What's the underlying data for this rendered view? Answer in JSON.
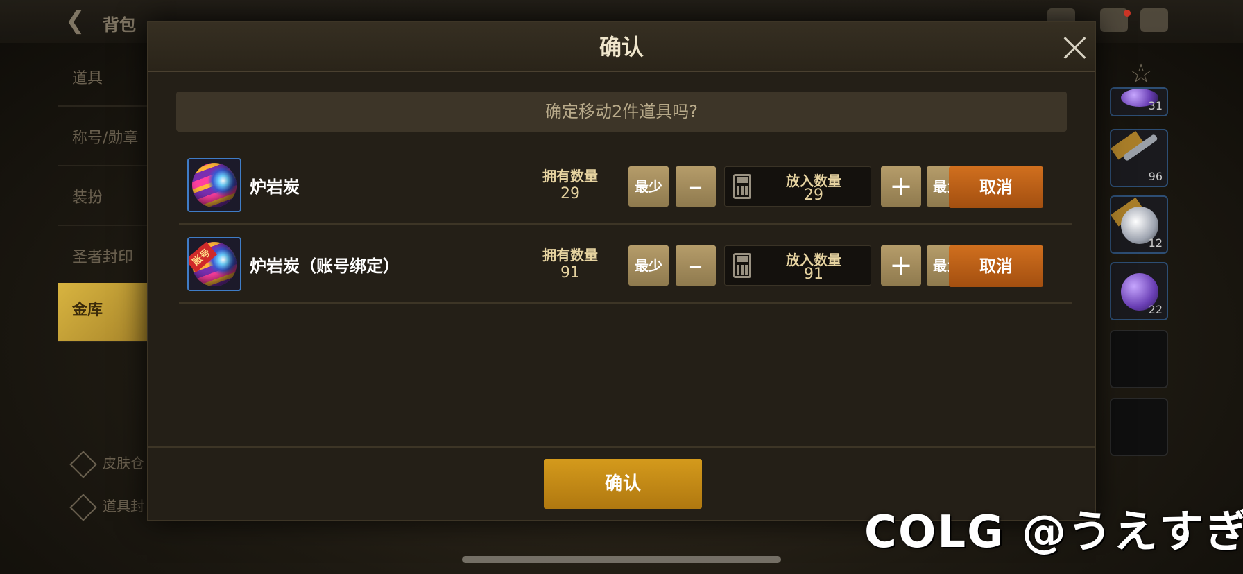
{
  "background": {
    "back_title": "背包",
    "sidebar": [
      "道具",
      "称号/勋章",
      "装扮",
      "圣者封印",
      "金库"
    ],
    "sidebar_active_index": 4,
    "sidebar_bottom": [
      "皮肤仓",
      "道具封"
    ],
    "right_slots": [
      {
        "count": "31"
      },
      {
        "count": "96"
      },
      {
        "count": "12"
      },
      {
        "count": "22"
      },
      {
        "count": ""
      },
      {
        "count": ""
      }
    ]
  },
  "dialog": {
    "title": "确认",
    "message": "确定移动2件道具吗?",
    "items": [
      {
        "name": "炉岩炭",
        "owned_label": "拥有数量",
        "owned_value": "29",
        "min_label": "最少",
        "minus_symbol": "–",
        "qty_label": "放入数量",
        "qty_value": "29",
        "plus_symbol": "+",
        "max_label": "最大",
        "cancel_label": "取消",
        "bound_tag": ""
      },
      {
        "name": "炉岩炭（账号绑定）",
        "owned_label": "拥有数量",
        "owned_value": "91",
        "min_label": "最少",
        "minus_symbol": "–",
        "qty_label": "放入数量",
        "qty_value": "91",
        "plus_symbol": "+",
        "max_label": "最大",
        "cancel_label": "取消",
        "bound_tag": "账号"
      }
    ],
    "confirm_label": "确认"
  },
  "watermark": "COLG @うえすぎ",
  "colors": {
    "cancel_orange": "#c0621a",
    "confirm_gold": "#c88a16",
    "step_button": "#a38c5c",
    "icon_border_blue": "#3f7cc6"
  }
}
